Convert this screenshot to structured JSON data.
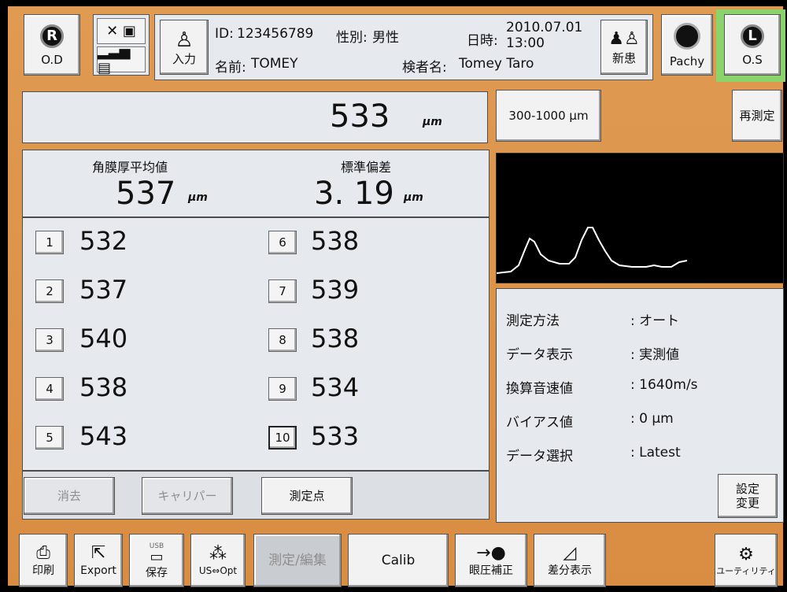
{
  "header": {
    "od_label": "O.D",
    "os_label": "O.S",
    "od_glyph": "R",
    "os_glyph": "L",
    "input_label": "入力",
    "id_label": "ID:",
    "id_value": "123456789",
    "sex_label": "性別:",
    "sex_value": "男性",
    "date_label": "日時:",
    "date_value": "2010.07.01",
    "time_value": "13:00",
    "name_label": "名前:",
    "name_value": "TOMEY",
    "examiner_label": "検者名:",
    "examiner_value": "Tomey Taro",
    "new_patient_label": "新患",
    "pachy_label": "Pachy"
  },
  "readout": {
    "value": "533",
    "unit": "μm"
  },
  "range_button": "300-1000 μm",
  "remeasure_button": "再測定",
  "stats": {
    "avg_label": "角膜厚平均値",
    "avg_value": "537",
    "sd_label": "標準偏差",
    "sd_value": "3. 19",
    "unit": "μm"
  },
  "measurements": [
    {
      "idx": "1",
      "value": "532"
    },
    {
      "idx": "2",
      "value": "537"
    },
    {
      "idx": "3",
      "value": "540"
    },
    {
      "idx": "4",
      "value": "538"
    },
    {
      "idx": "5",
      "value": "543"
    },
    {
      "idx": "6",
      "value": "538"
    },
    {
      "idx": "7",
      "value": "539"
    },
    {
      "idx": "8",
      "value": "538"
    },
    {
      "idx": "9",
      "value": "534"
    },
    {
      "idx": "10",
      "value": "533"
    }
  ],
  "soft_buttons": {
    "clear": "消去",
    "caliper": "キャリパー",
    "points": "測定点"
  },
  "settings": {
    "rows": [
      {
        "label": "測定方法",
        "value": ": オート"
      },
      {
        "label": "データ表示",
        "value": ": 実測値"
      },
      {
        "label": "換算音速値",
        "value": ": 1640m/s"
      },
      {
        "label": "バイアス値",
        "value": ": 0 μm"
      },
      {
        "label": "データ選択",
        "value": ": Latest"
      }
    ],
    "change_line1": "設定",
    "change_line2": "変更"
  },
  "toolbar": {
    "print": "印刷",
    "export": "Export",
    "save": "保存",
    "save_badge": "USB",
    "us_opt": "US⇔Opt",
    "measure_edit": "測定/編集",
    "calib": "Calib",
    "iop_correction": "眼圧補正",
    "diff_display": "差分表示",
    "utility": "ユーティリティ"
  },
  "colors": {
    "frame": "#d98d42",
    "panel": "#e6e9ee",
    "active_eye": "#8bd36b",
    "waveform": "#ffffff"
  }
}
